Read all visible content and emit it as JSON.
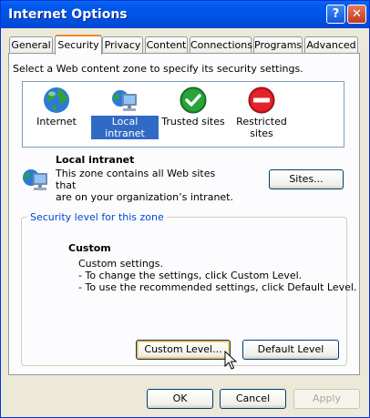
{
  "window": {
    "title": "Internet Options"
  },
  "tabs": [
    {
      "label": "General"
    },
    {
      "label": "Security"
    },
    {
      "label": "Privacy"
    },
    {
      "label": "Content"
    },
    {
      "label": "Connections"
    },
    {
      "label": "Programs"
    },
    {
      "label": "Advanced"
    }
  ],
  "active_tab": "Security",
  "security": {
    "intro": "Select a Web content zone to specify its security settings.",
    "zones": [
      {
        "label": "Internet",
        "icon": "globe-icon"
      },
      {
        "label": "Local intranet",
        "icon": "intranet-icon",
        "selected": true
      },
      {
        "label": "Trusted sites",
        "icon": "checkmark-icon"
      },
      {
        "label": "Restricted sites",
        "icon": "restricted-icon"
      }
    ],
    "selected_zone": {
      "title": "Local intranet",
      "desc1": "This zone contains all Web sites that",
      "desc2": "are on your organization’s intranet.",
      "sites_button": "Sites..."
    },
    "level_group": {
      "legend": "Security level for this zone",
      "title": "Custom",
      "lines": [
        "Custom settings.",
        "- To change the settings, click Custom Level.",
        "- To use the recommended settings, click Default Level."
      ],
      "custom_button": "Custom Level...",
      "default_button": "Default Level"
    }
  },
  "footer": {
    "ok": "OK",
    "cancel": "Cancel",
    "apply": "Apply"
  },
  "colors": {
    "titlebar": "#0054e3",
    "selection": "#316ac5",
    "legend": "#0046d5"
  }
}
